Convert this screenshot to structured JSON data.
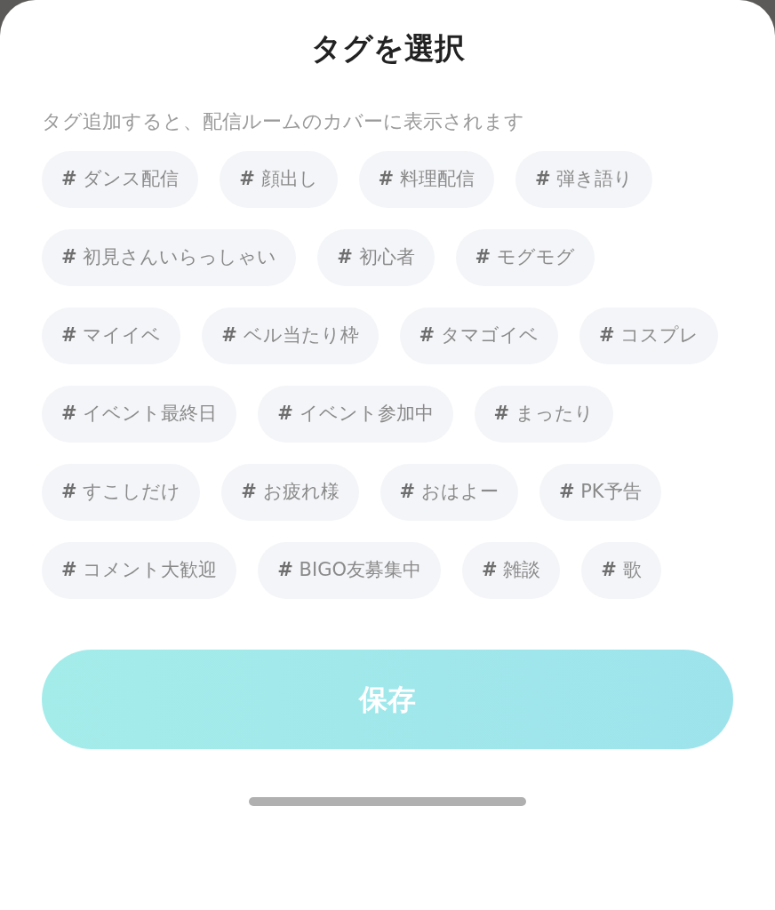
{
  "title": "タグを選択",
  "subtitle": "タグ追加すると、配信ルームのカバーに表示されます",
  "tags": [
    {
      "label": "**#** ダンス配信"
    },
    {
      "label": "**#** 顔出し"
    },
    {
      "label": "**#** 料理配信"
    },
    {
      "label": "**#** 弾き語り"
    },
    {
      "label": "**#** 初見さんいらっしゃい"
    },
    {
      "label": "**#** 初心者"
    },
    {
      "label": "**#** モグモグ"
    },
    {
      "label": "**#** マイイベ"
    },
    {
      "label": "**#** ベル当たり枠"
    },
    {
      "label": "**#** タマゴイベ"
    },
    {
      "label": "**#** コスプレ"
    },
    {
      "label": "**#** イベント最終日"
    },
    {
      "label": "**#** イベント参加中"
    },
    {
      "label": "**#** まったり"
    },
    {
      "label": "**#** すこしだけ"
    },
    {
      "label": "**#** お疲れ様"
    },
    {
      "label": "**#** おはよー"
    },
    {
      "label": "**#** PK予告"
    },
    {
      "label": "**#** コメント大歓迎"
    },
    {
      "label": "**#** BIGO友募集中"
    },
    {
      "label": "**#** 雑談"
    },
    {
      "label": "**#** 歌"
    }
  ],
  "save_button": {
    "label": "保存"
  }
}
